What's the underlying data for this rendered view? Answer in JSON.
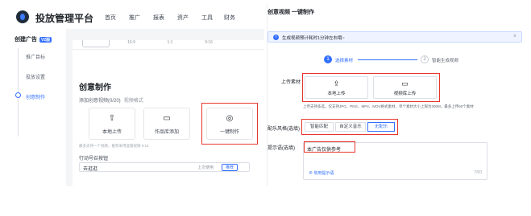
{
  "left": {
    "brand": "投放管理平台",
    "nav": [
      "首页",
      "推广",
      "报表",
      "资产",
      "工具",
      "财务"
    ],
    "sidebar": {
      "header": "创建广告",
      "header_tag": "V2版",
      "items": [
        "推广目标",
        "投放设置",
        "创意制作"
      ]
    },
    "strip_buttons": [
      "",
      "16:9",
      "1:1",
      "9:16"
    ],
    "section_title": "创意制作",
    "subtitle": "添加创意视频(0/20)",
    "subtitle_hint": "视频格式",
    "cards": [
      "本地上传",
      "作品库添加",
      "一键制作"
    ],
    "note": "最多支持一个视频，推荐采用竖版视频 9:16",
    "field_label": "行动号召按钮",
    "input_value": "去逛逛",
    "input_mid": "上次使用",
    "input_btn": "推荐"
  },
  "right": {
    "title": "创意视频 一键制作",
    "info_text": "生成视频预计耗时1分钟左右哦~",
    "info_close": "×",
    "steps": [
      "选择素材",
      "智能生成视频"
    ],
    "upload_label": "上传素材",
    "upload_cards": [
      "本地上传",
      "视频库上传"
    ],
    "formats": "上传支持多选，仅支持JPG、PNG、MP4、MOV格式素材，单个素材大小上限为300M，最多上传60个素材",
    "music_label": "配乐风格(选填)",
    "music_options": [
      "智能匹配",
      "自定义音乐",
      "无配乐"
    ],
    "music_selected": 2,
    "prompt_label": "提示语(选填)",
    "prompt_value": "本广告仅供参考",
    "prompt_hint": "常用提示语",
    "prompt_count": "7/50"
  },
  "colors": {
    "accent": "#3370ff",
    "highlight": "#e8362c"
  }
}
